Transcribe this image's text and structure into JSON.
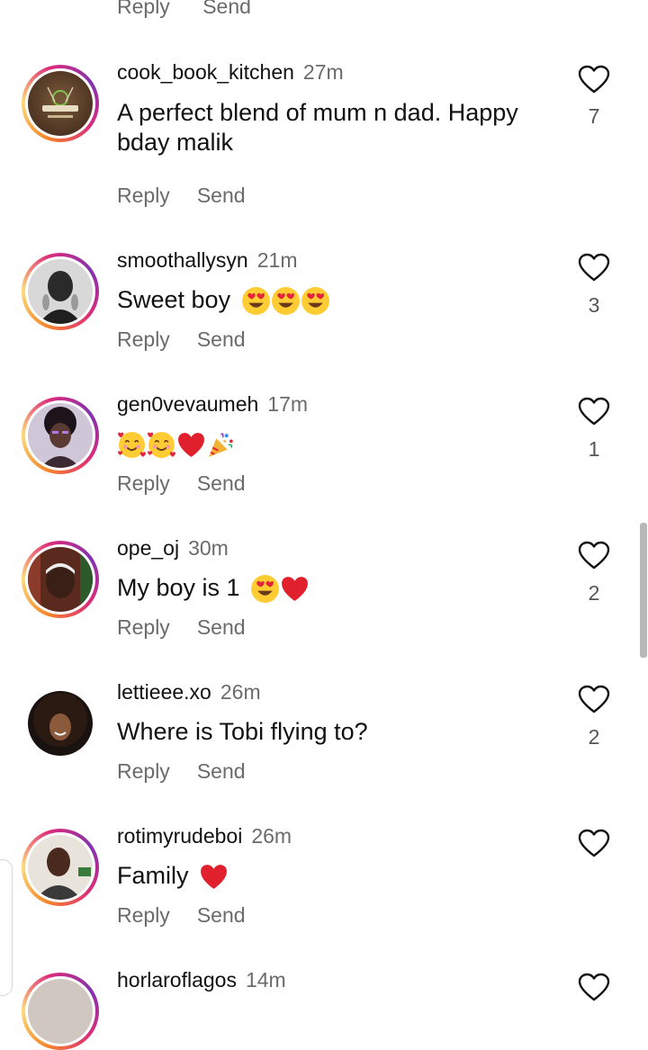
{
  "actions": {
    "reply": "Reply",
    "send": "Send"
  },
  "top_partial": {
    "reply": "Reply",
    "send": "Send"
  },
  "comments": [
    {
      "username": "cook_book_kitchen",
      "time": "27m",
      "text": "A perfect blend of mum n dad. Happy bday malik",
      "likes": "7",
      "avatar": "cookbook-logo-avatar",
      "story_ring": true
    },
    {
      "username": "smoothallysyn",
      "time": "21m",
      "text": "Sweet boy",
      "emojis": [
        "heart-eyes",
        "heart-eyes",
        "heart-eyes"
      ],
      "likes": "3",
      "avatar": "profile-photo",
      "story_ring": true
    },
    {
      "username": "gen0vevaumeh",
      "time": "17m",
      "text": "",
      "emojis": [
        "smiling-face-with-hearts",
        "smiling-face-with-hearts",
        "red-heart",
        "party-popper"
      ],
      "likes": "1",
      "avatar": "profile-photo",
      "story_ring": true
    },
    {
      "username": "ope_oj",
      "time": "30m",
      "text": "My boy is 1",
      "emojis": [
        "heart-eyes",
        "red-heart"
      ],
      "likes": "2",
      "avatar": "profile-photo",
      "story_ring": true
    },
    {
      "username": "lettieee.xo",
      "time": "26m",
      "text": "Where is Tobi flying to?",
      "likes": "2",
      "avatar": "profile-photo",
      "story_ring": false
    },
    {
      "username": "rotimyrudeboi",
      "time": "26m",
      "text": "Family",
      "emojis": [
        "red-heart"
      ],
      "likes": "",
      "avatar": "profile-photo",
      "story_ring": true
    },
    {
      "username": "horlaroflagos",
      "time": "14m",
      "text": "",
      "likes": "",
      "avatar": "profile-photo",
      "story_ring": true
    }
  ],
  "colors": {
    "ring_start": "#f58529",
    "ring_mid": "#dd2a7b",
    "ring_end": "#8134af",
    "muted": "#6b6b6b",
    "heart_red": "#e0202c"
  }
}
